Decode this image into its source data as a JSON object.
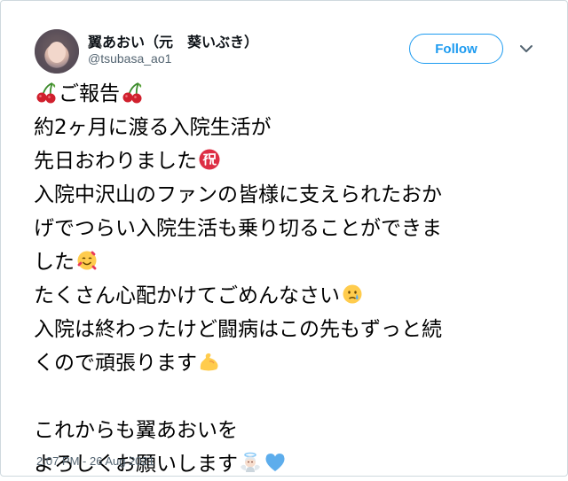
{
  "tweet": {
    "author_name": "翼あおい（元　葵いぶき）",
    "author_handle": "@tsubasa_ao1",
    "follow_label": "Follow",
    "timestamp": "2:07 PM - 26 Aug 2021",
    "lines": {
      "l1": "ご報告",
      "l2": "約2ヶ月に渡る入院生活が",
      "l3": "先日おわりました",
      "l4": "入院中沢山のファンの皆様に支えられたおか",
      "l5": "げでつらい入院生活も乗り切ることができま",
      "l6": "した",
      "l7": "たくさん心配かけてごめんなさい",
      "l8": "入院は終わったけど闘病はこの先もずっと続",
      "l9": "くので頑張ります",
      "l10": "これからも翼あおいを",
      "l11": "よろしくお願いします"
    },
    "emoji_names": [
      "cherries",
      "congratulation-ideograph",
      "smiling-face-with-hearts",
      "crying-face",
      "flexed-biceps",
      "angel-face",
      "blue-heart"
    ]
  },
  "colors": {
    "link_blue": "#1d9bf0",
    "secondary_text": "#536471",
    "border": "#cfd9de"
  }
}
